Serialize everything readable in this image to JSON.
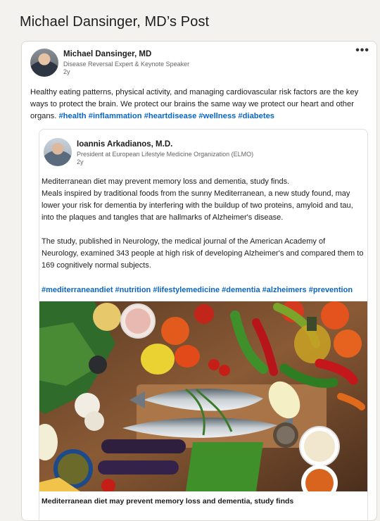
{
  "page": {
    "title": "Michael Dansinger, MD’s Post"
  },
  "post": {
    "author": {
      "name": "Michael Dansinger, MD",
      "headline": "Disease Reversal Expert & Keynote Speaker",
      "time": "2y"
    },
    "more_label": "•••",
    "text": "Healthy eating patterns, physical activity, and managing cardiovascular risk factors are the key ways to protect the brain. We protect our brains the same way we protect our heart and other organs.",
    "hashtags": [
      "#health",
      "#inflammation",
      "#heartdisease",
      "#wellness",
      "#diabetes"
    ]
  },
  "shared_post": {
    "author": {
      "name": "Ioannis Arkadianos, M.D.",
      "headline": "President at European Lifestyle Medicine Organization (ELMO)",
      "time": "2y"
    },
    "lines": [
      "Mediterranean diet may prevent memory loss and dementia, study finds.",
      "Meals inspired by traditional foods from the sunny Mediterranean, a new study found, may lower your risk for dementia by interfering with the buildup of two proteins, amyloid and tau, into the plaques and tangles that are hallmarks of Alzheimer's disease.",
      "The study, published in Neurology, the medical journal of the American Academy of Neurology, examined 343 people at high risk of developing Alzheimer's and compared them to 169 cognitively normal subjects."
    ],
    "hashtags": [
      "#mediterraneandiet",
      "#nutrition",
      "#lifestylemedicine",
      "#dementia",
      "#alzheimers",
      "#prevention"
    ],
    "image_caption": "Mediterranean diet may prevent memory loss and dementia, study finds"
  },
  "colors": {
    "link": "#0a66c2",
    "background": "#f3f2ef",
    "card": "#ffffff"
  }
}
